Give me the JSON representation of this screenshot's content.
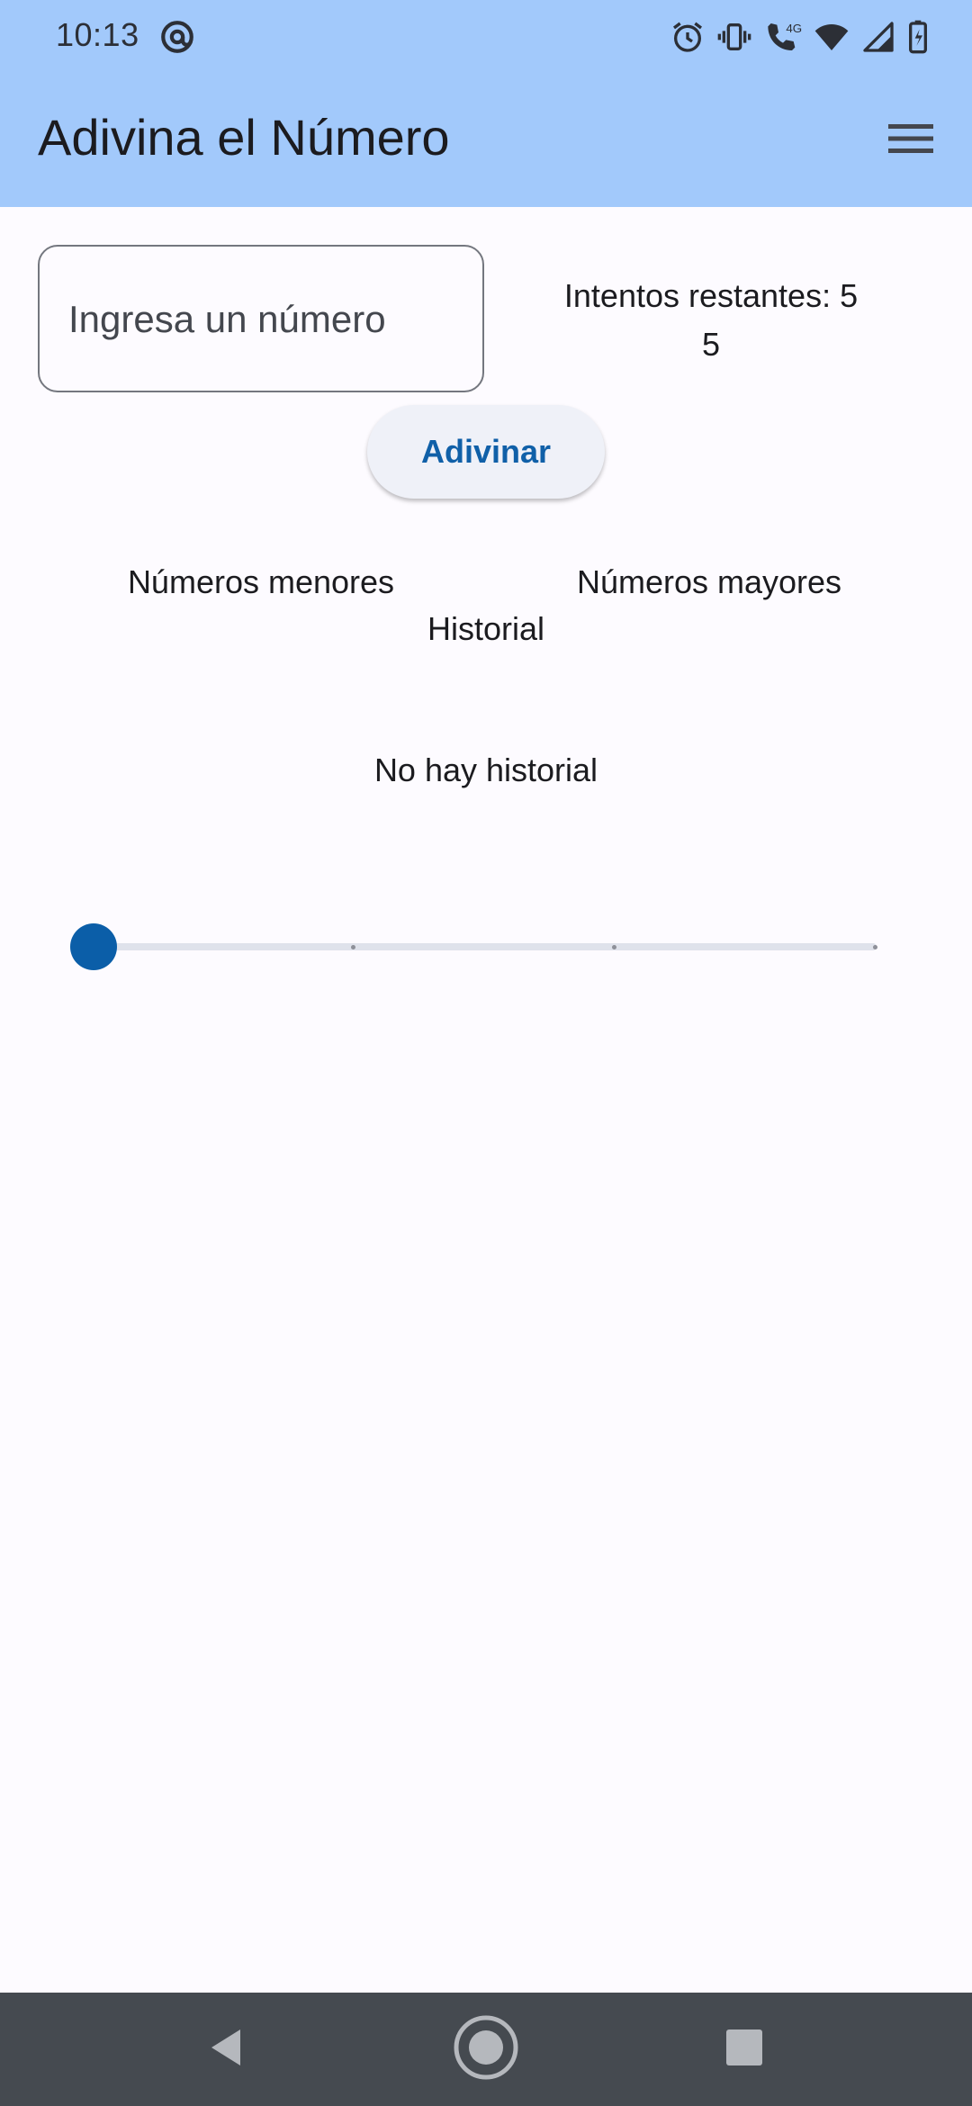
{
  "status_bar": {
    "time": "10:13",
    "icons": [
      "at-sign-icon",
      "alarm-icon",
      "vibrate-icon",
      "volte-call-icon",
      "wifi-icon",
      "signal-icon",
      "battery-charging-icon"
    ],
    "network_label": "4G"
  },
  "app_bar": {
    "title": "Adivina el Número",
    "menu_icon": "menu-icon"
  },
  "form": {
    "input_value": "",
    "input_placeholder": "Ingresa un número",
    "attempts_label": "Intentos restantes: 5",
    "attempts_value": "5",
    "guess_button": "Adivinar"
  },
  "columns": {
    "lower_label": "Números menores",
    "higher_label": "Números mayores",
    "history_title": "Historial",
    "empty_history": "No hay historial"
  },
  "slider": {
    "value": 0,
    "min": 0,
    "max": 3,
    "divisions": 3
  },
  "colors": {
    "app_bar": "#a2c9fb",
    "primary": "#0b5ea8",
    "background": "#fdfbff",
    "nav_bar": "#454a50"
  },
  "nav_bar": {
    "icons": [
      "back-icon",
      "home-icon",
      "recents-icon"
    ]
  }
}
